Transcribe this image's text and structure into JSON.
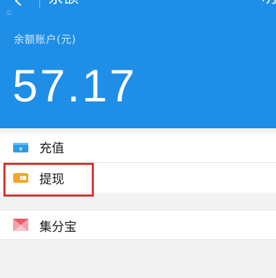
{
  "nav": {
    "title": "余额",
    "right_action": "明",
    "watermark": "©"
  },
  "balance": {
    "label": "余额账户(元)",
    "amount": "57.17"
  },
  "rows": [
    {
      "label": "充值",
      "icon": "wallet-card-icon"
    },
    {
      "label": "提现",
      "icon": "wallet-icon"
    },
    {
      "label": "集分宝",
      "icon": "jifenbao-icon"
    }
  ],
  "colors": {
    "header_bg": "#1f8ee7",
    "recharge_icon": "#2e9ae8",
    "withdraw_icon": "#f5a623",
    "jifenbao_icon": "#e85a6a",
    "highlight": "#d0342c"
  }
}
